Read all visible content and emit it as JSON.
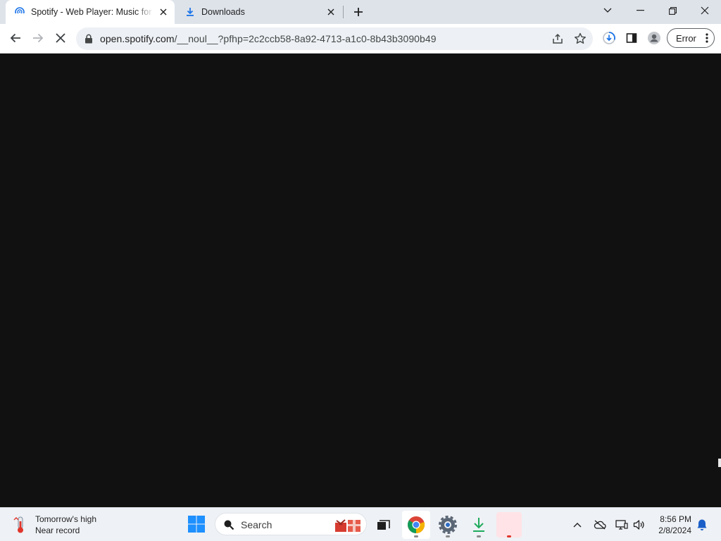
{
  "browser": {
    "tabs": [
      {
        "title": "Spotify - Web Player: Music for everyone",
        "favicon": "spotify-broadcast-icon",
        "active": true
      },
      {
        "title": "Downloads",
        "favicon": "download-icon",
        "active": false
      }
    ],
    "new_tab_icon": "plus-icon",
    "window_controls": [
      "tab-search-icon",
      "minimize-icon",
      "restore-icon",
      "close-icon"
    ],
    "toolbar": {
      "url_domain": "open.spotify.com",
      "url_path": "/__noul__?pfhp=2c2ccb58-8a92-4713-a1c0-8b43b3090b49",
      "profile_button": "Error"
    }
  },
  "page": {
    "background": "#111111"
  },
  "taskbar": {
    "weather": {
      "line1": "Tomorrow's high",
      "line2": "Near record"
    },
    "search_placeholder": "Search",
    "apps": [
      "windows-start-icon",
      "task-view-icon",
      "chrome-icon",
      "settings-icon",
      "download-arrow-icon",
      "pink-app-icon"
    ],
    "clock": {
      "time": "8:56 PM",
      "date": "2/8/2024"
    }
  },
  "colors": {
    "tab_strip": "#dee3ea",
    "omnibox": "#edf0f4",
    "taskbar": "#eef1f5",
    "download_badge": "#1a73e8"
  }
}
